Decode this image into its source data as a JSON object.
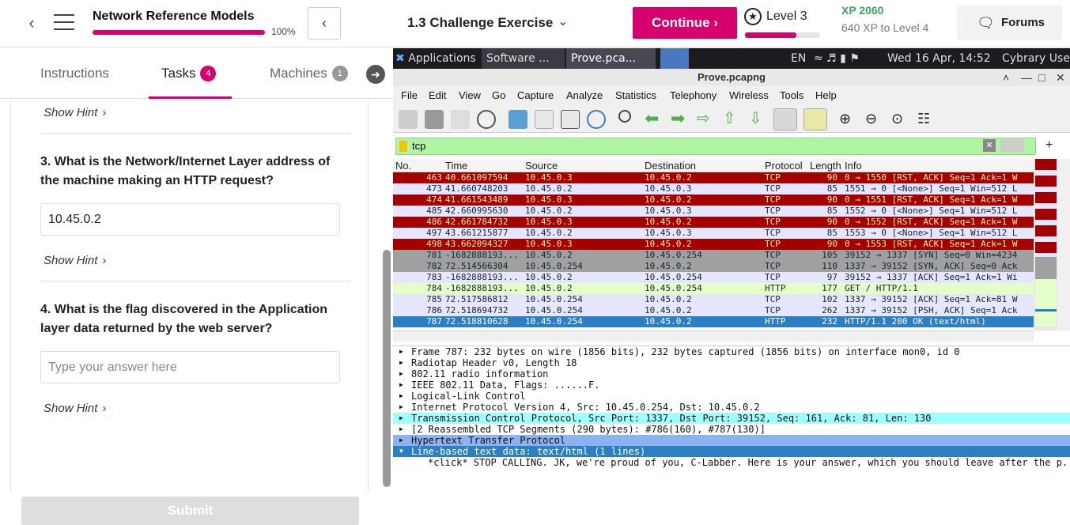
{
  "topbar": {
    "course_title": "Network Reference Models",
    "course_progress": "100%",
    "course_progress_value": 1.0,
    "exercise_title": "1.3 Challenge Exercise",
    "continue_label": "Continue",
    "level_label": "Level 3",
    "level_progress": 0.68,
    "xp": "XP 2060",
    "xp_to_level": "640 XP to Level 4",
    "forums_label": "Forums",
    "accent": "#d6006e"
  },
  "tabs": [
    {
      "label": "Instructions"
    },
    {
      "label": "Tasks",
      "badge": "4"
    },
    {
      "label": "Machines",
      "badge": "1"
    }
  ],
  "tasks": {
    "hint_label": "Show Hint",
    "q3": "3. What is the Network/Internet Layer address of the machine making an HTTP request?",
    "q3_answer": "10.45.0.2",
    "q4": "4. What is the flag discovered in the Application layer data returned by the web server?",
    "q4_placeholder": "Type your answer here",
    "submit_label": "Submit"
  },
  "desktop_panel": {
    "applications": "Applications",
    "tasks": [
      "Software ...",
      "Prove.pca..."
    ],
    "lang": "EN",
    "clock": "Wed 16 Apr, 14:52",
    "user": "Cybrary User"
  },
  "wireshark": {
    "window_title": "Prove.pcapng",
    "menu": [
      "File",
      "Edit",
      "View",
      "Go",
      "Capture",
      "Analyze",
      "Statistics",
      "Telephony",
      "Wireless",
      "Tools",
      "Help"
    ],
    "filter": "tcp",
    "columns": [
      "No.",
      "Time",
      "Source",
      "Destination",
      "Protocol",
      "Length",
      "Info"
    ],
    "packets": [
      {
        "no": "463",
        "time": "40.661097594",
        "src": "10.45.0.3",
        "dst": "10.45.0.2",
        "proto": "TCP",
        "len": "90",
        "info": "0 → 1550 [RST, ACK] Seq=1 Ack=1 W",
        "style": "rst"
      },
      {
        "no": "473",
        "time": "41.660748203",
        "src": "10.45.0.2",
        "dst": "10.45.0.3",
        "proto": "TCP",
        "len": "85",
        "info": "1551 → 0 [<None>] Seq=1 Win=512 L",
        "style": "tcp"
      },
      {
        "no": "474",
        "time": "41.661543489",
        "src": "10.45.0.3",
        "dst": "10.45.0.2",
        "proto": "TCP",
        "len": "90",
        "info": "0 → 1551 [RST, ACK] Seq=1 Ack=1 W",
        "style": "rst"
      },
      {
        "no": "485",
        "time": "42.660995630",
        "src": "10.45.0.2",
        "dst": "10.45.0.3",
        "proto": "TCP",
        "len": "85",
        "info": "1552 → 0 [<None>] Seq=1 Win=512 L",
        "style": "tcp"
      },
      {
        "no": "486",
        "time": "42.661784732",
        "src": "10.45.0.3",
        "dst": "10.45.0.2",
        "proto": "TCP",
        "len": "90",
        "info": "0 → 1552 [RST, ACK] Seq=1 Ack=1 W",
        "style": "rst"
      },
      {
        "no": "497",
        "time": "43.661215877",
        "src": "10.45.0.2",
        "dst": "10.45.0.3",
        "proto": "TCP",
        "len": "85",
        "info": "1553 → 0 [<None>] Seq=1 Win=512 L",
        "style": "tcp"
      },
      {
        "no": "498",
        "time": "43.662094327",
        "src": "10.45.0.3",
        "dst": "10.45.0.2",
        "proto": "TCP",
        "len": "90",
        "info": "0 → 1553 [RST, ACK] Seq=1 Ack=1 W",
        "style": "rst"
      },
      {
        "no": "781",
        "time": "-1682888193...",
        "src": "10.45.0.2",
        "dst": "10.45.0.254",
        "proto": "TCP",
        "len": "105",
        "info": "39152 → 1337 [SYN] Seq=0 Win=4234",
        "style": "gray"
      },
      {
        "no": "782",
        "time": "72.514566304",
        "src": "10.45.0.254",
        "dst": "10.45.0.2",
        "proto": "TCP",
        "len": "110",
        "info": "1337 → 39152 [SYN, ACK] Seq=0 Ack",
        "style": "gray"
      },
      {
        "no": "783",
        "time": "-1682888193...",
        "src": "10.45.0.2",
        "dst": "10.45.0.254",
        "proto": "TCP",
        "len": "97",
        "info": "39152 → 1337 [ACK] Seq=1 Ack=1 Wi",
        "style": "tcp"
      },
      {
        "no": "784",
        "time": "-1682888193...",
        "src": "10.45.0.2",
        "dst": "10.45.0.254",
        "proto": "HTTP",
        "len": "177",
        "info": "GET / HTTP/1.1",
        "style": "http"
      },
      {
        "no": "785",
        "time": "72.517586812",
        "src": "10.45.0.254",
        "dst": "10.45.0.2",
        "proto": "TCP",
        "len": "102",
        "info": "1337 → 39152 [ACK] Seq=1 Ack=81 W",
        "style": "tcp"
      },
      {
        "no": "786",
        "time": "72.518694732",
        "src": "10.45.0.254",
        "dst": "10.45.0.2",
        "proto": "TCP",
        "len": "262",
        "info": "1337 → 39152 [PSH, ACK] Seq=1 Ack",
        "style": "tcp"
      },
      {
        "no": "787",
        "time": "72.518810628",
        "src": "10.45.0.254",
        "dst": "10.45.0.2",
        "proto": "HTTP",
        "len": "232",
        "info": "HTTP/1.1 200 OK  (text/html)",
        "style": "sel"
      }
    ],
    "details": [
      {
        "text": "Frame 787: 232 bytes on wire (1856 bits), 232 bytes captured (1856 bits) on interface mon0, id 0",
        "style": ""
      },
      {
        "text": "Radiotap Header v0, Length 18",
        "style": ""
      },
      {
        "text": "802.11 radio information",
        "style": ""
      },
      {
        "text": "IEEE 802.11 Data, Flags: ......F.",
        "style": ""
      },
      {
        "text": "Logical-Link Control",
        "style": ""
      },
      {
        "text": "Internet Protocol Version 4, Src: 10.45.0.254, Dst: 10.45.0.2",
        "style": ""
      },
      {
        "text": "Transmission Control Protocol, Src Port: 1337, Dst Port: 39152, Seq: 161, Ack: 81, Len: 130",
        "style": "hl-tcp"
      },
      {
        "text": "[2 Reassembled TCP Segments (290 bytes): #786(160), #787(130)]",
        "style": ""
      },
      {
        "text": "Hypertext Transfer Protocol",
        "style": "hl-http"
      },
      {
        "text": "Line-based text data: text/html (1 lines)",
        "style": "hl-sel",
        "expanded": true
      },
      {
        "text": "*click* STOP CALLING. JK, we're proud of you, C-Labber. Here is your answer, which you should leave after the p...",
        "style": "child"
      }
    ]
  }
}
